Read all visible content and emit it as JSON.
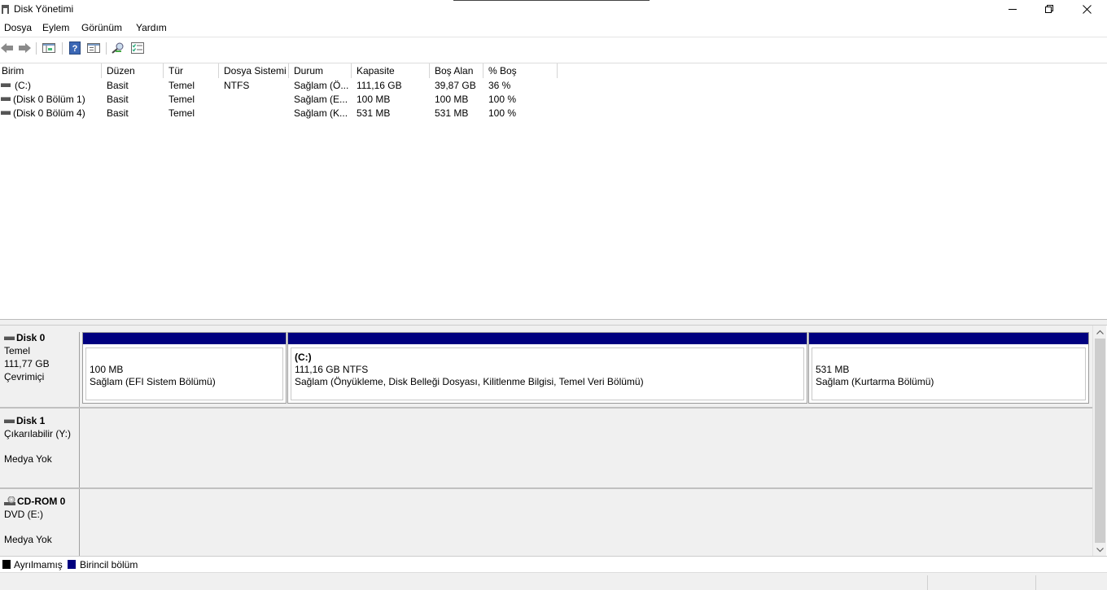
{
  "window": {
    "title": "Disk Yönetimi",
    "icon": "disk-management-icon"
  },
  "menu": [
    "Dosya",
    "Eylem",
    "Görünüm",
    "Yardım"
  ],
  "toolbar": {
    "icons": [
      "back-icon",
      "forward-icon",
      "console-tree-icon",
      "help-icon",
      "show-hide-icon",
      "connect-icon",
      "properties-icon"
    ]
  },
  "volumes": {
    "columns": [
      "Birim",
      "Düzen",
      "Tür",
      "Dosya Sistemi",
      "Durum",
      "Kapasite",
      "Boş Alan",
      "% Boş"
    ],
    "rows": [
      [
        "(C:)",
        "Basit",
        "Temel",
        "NTFS",
        "Sağlam (Ö...",
        "111,16 GB",
        "39,87 GB",
        "36 %"
      ],
      [
        "(Disk 0 Bölüm 1)",
        "Basit",
        "Temel",
        "",
        "Sağlam (E...",
        "100 MB",
        "100 MB",
        "100 %"
      ],
      [
        "(Disk 0 Bölüm 4)",
        "Basit",
        "Temel",
        "",
        "Sağlam (K...",
        "531 MB",
        "531 MB",
        "100 %"
      ]
    ]
  },
  "disks": [
    {
      "name": "Disk 0",
      "type": "Temel",
      "size": "111,77 GB",
      "status": "Çevrimiçi",
      "partitions": [
        {
          "title": "",
          "size": "100 MB",
          "status": "Sağlam (EFI Sistem Bölümü)"
        },
        {
          "title": "(C:)",
          "size": "111,16 GB NTFS",
          "status": "Sağlam (Önyükleme, Disk Belleği Dosyası, Kilitlenme Bilgisi, Temel Veri Bölümü)"
        },
        {
          "title": "",
          "size": "531 MB",
          "status": "Sağlam (Kurtarma Bölümü)"
        }
      ]
    },
    {
      "name": "Disk 1",
      "type": "Çıkarılabilir (Y:)",
      "size": "",
      "status": "Medya Yok"
    },
    {
      "name": "CD-ROM 0",
      "type": "DVD (E:)",
      "size": "",
      "status": "Medya Yok"
    }
  ],
  "legend": [
    {
      "label": "Ayrılmamış",
      "color": "#000000"
    },
    {
      "label": "Birincil bölüm",
      "color": "#00007f"
    }
  ]
}
